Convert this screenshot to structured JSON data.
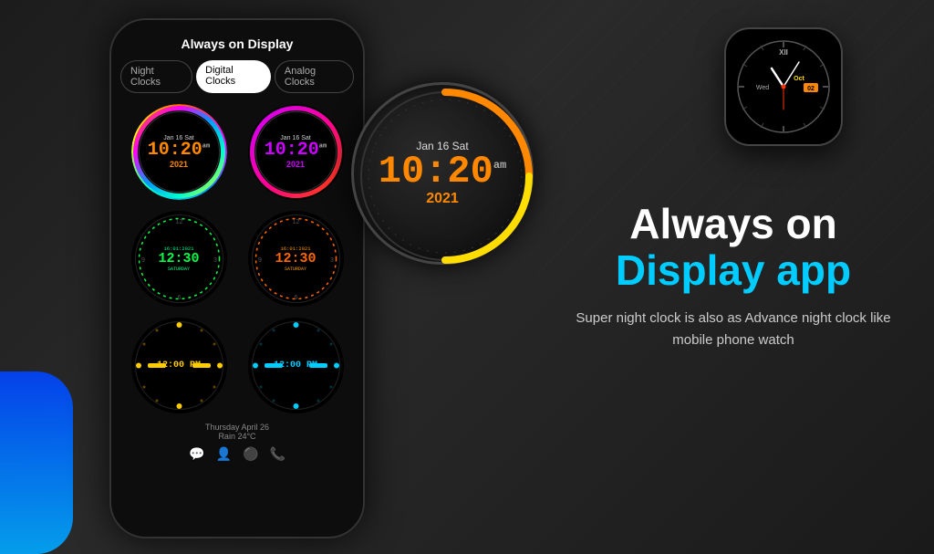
{
  "app": {
    "title": "Always on Display",
    "subtitle_white": "Always on",
    "subtitle_cyan": "Display app",
    "description": "Super night clock is also as Advance night clock like mobile phone watch"
  },
  "tabs": [
    {
      "id": "night",
      "label": "Night Clocks",
      "active": false
    },
    {
      "id": "digital",
      "label": "Digital Clocks",
      "active": true
    },
    {
      "id": "analog",
      "label": "Analog Clocks",
      "active": false
    }
  ],
  "clocks": [
    {
      "id": 1,
      "date": "Jan 16 Sat",
      "time": "10:20",
      "ampm": "am",
      "year": "2021",
      "type": "rainbow"
    },
    {
      "id": 2,
      "date": "Jan 16 Sat",
      "time": "10:20",
      "ampm": "am",
      "year": "2021",
      "type": "pink"
    },
    {
      "id": 3,
      "date": "16:01:2021",
      "time": "12:30",
      "day": "SATURDAY",
      "type": "digital-green"
    },
    {
      "id": 4,
      "date": "16:01:2021",
      "time": "12:30",
      "day": "SATURDAY",
      "type": "digital-orange"
    },
    {
      "id": 5,
      "time": "12:00 PM",
      "type": "dots-yellow"
    },
    {
      "id": 6,
      "time": "12:00 PM",
      "type": "dots-cyan"
    }
  ],
  "large_clock": {
    "date": "Jan 16 Sat",
    "time": "10:20",
    "ampm": "am",
    "year": "2021"
  },
  "watch": {
    "day": "Wed",
    "month": "Oct",
    "date": "02",
    "xii_marker": "XII"
  },
  "weather": {
    "line1": "Thursday April 26",
    "line2": "Rain 24°C"
  }
}
